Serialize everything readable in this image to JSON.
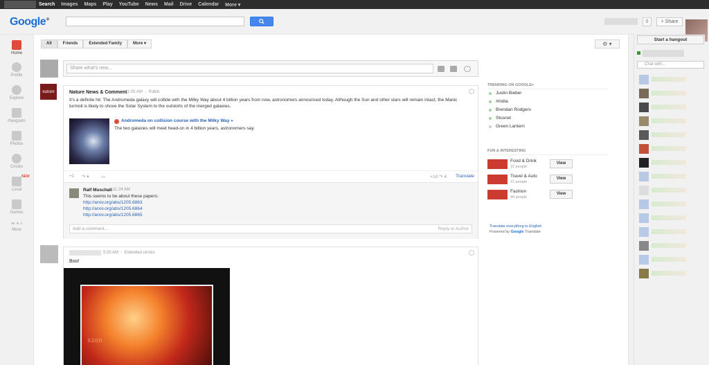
{
  "gbar": {
    "items": [
      "Search",
      "Images",
      "Maps",
      "Play",
      "YouTube",
      "News",
      "Mail",
      "Drive",
      "Calendar",
      "More ▾"
    ]
  },
  "header": {
    "logo_google": "Google",
    "logo_plus": "+",
    "notification_count": "0",
    "share_label": "+ Share"
  },
  "leftrail": {
    "items": [
      {
        "label": "Home",
        "icon": "home-icon"
      },
      {
        "label": "Profile",
        "icon": "profile-icon"
      },
      {
        "label": "Explore",
        "icon": "explore-icon"
      },
      {
        "label": "Hangouts",
        "icon": "hangouts-icon"
      },
      {
        "label": "Photos",
        "icon": "photos-icon"
      },
      {
        "label": "Circles",
        "icon": "circles-icon"
      },
      {
        "label": "Local",
        "icon": "local-icon",
        "badge": "NEW"
      },
      {
        "label": "Games",
        "icon": "games-icon"
      },
      {
        "label": "More",
        "icon": "more-icon"
      }
    ]
  },
  "stream": {
    "tabs": [
      "All",
      "Friends",
      "Extended Family",
      "More ▾"
    ],
    "gear_label": "⚙ ▾",
    "sharebox_placeholder": "Share what's new..."
  },
  "post1": {
    "author": "Nature News & Comment",
    "avatar_text": "nature",
    "time": "11:05 AM",
    "visibility": "Public",
    "text": "It's a definite hit: The Andromeda galaxy will collide with the Milky Way about 4 billion years from now, astronomers announced today. Although the Sun and other stars will remain intact, the Manic turmoil is likely to shove the Solar System to the outskirts of the merged galaxies.",
    "link_title": "Andromeda on collision course with the Milky Way »",
    "link_desc": "The two galaxies will meet head-on in 4 billion years, astronomers say.",
    "plusone": "+1",
    "share_glyph": "↷ ▾",
    "hangout_glyph": "▭",
    "counts": "+10  ↷ 4",
    "translate": "Translate",
    "comment": {
      "author": "Ralf Muschall",
      "time": "11:24 AM",
      "text": "This seems to be about these papers:",
      "links": [
        "http://arxiv.org/abs/1205.6863",
        "http://arxiv.org/abs/1205.6864",
        "http://arxiv.org/abs/1205.6865"
      ]
    },
    "add_comment": "Add a comment...",
    "reply_to_author": "Reply to Author"
  },
  "post2": {
    "time": "5:35 AM",
    "visibility": "Extended circles",
    "text": "Boo!",
    "image_text": "sion"
  },
  "trending": {
    "header": "TRENDING ON GOOGLE+",
    "items": [
      "Justin Bieber",
      "#India",
      "Brendan Rodgers",
      "Stusnet",
      "Green Lantern"
    ]
  },
  "fun": {
    "header": "FUN & INTERESTING",
    "items": [
      {
        "name": "Food & Drink",
        "count": "22 people",
        "view": "View",
        "color": "#c0392b"
      },
      {
        "name": "Travel & Auto",
        "count": "21 people",
        "view": "View",
        "color": "#d9362b"
      },
      {
        "name": "Fashion",
        "count": "44 people",
        "view": "View",
        "color": "#e2442e"
      }
    ]
  },
  "translate_link": "Translate everything to English",
  "powered_by": "Powered by",
  "powered_google": "Google",
  "powered_translate": "Translate",
  "chat": {
    "hangout_button": "Start a hangout",
    "search_placeholder": "Chat with...",
    "row_count": 16
  },
  "colors": {
    "accent_red": "#dd4b39",
    "link_blue": "#2962b5",
    "search_blue": "#4787ed",
    "trend_dot": "#9ed59b"
  }
}
